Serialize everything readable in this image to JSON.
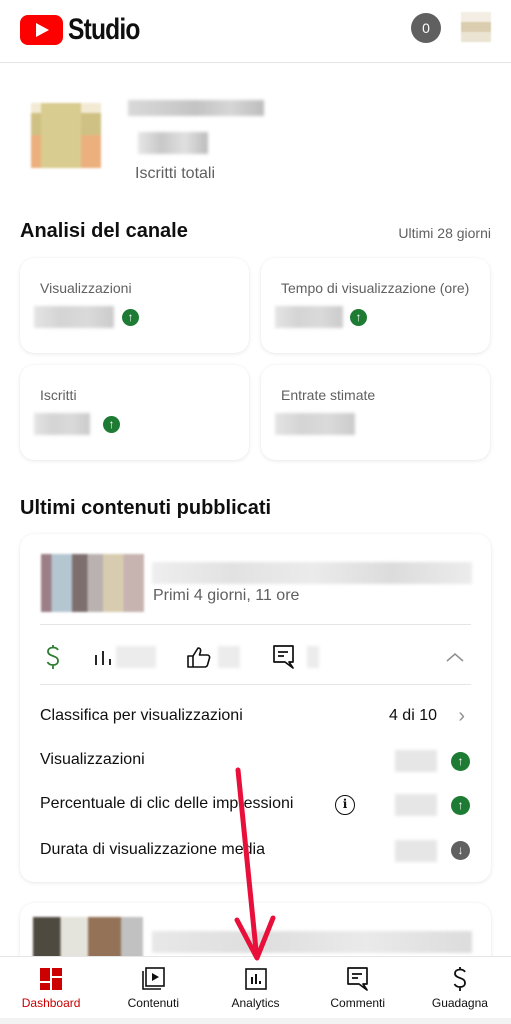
{
  "header": {
    "app_name": "Studio",
    "notification_count": "0"
  },
  "channel": {
    "subscribers_label": "Iscritti totali"
  },
  "analytics": {
    "title": "Analisi del canale",
    "range": "Ultimi 28 giorni",
    "cards": [
      {
        "label": "Visualizzazioni",
        "trend": "up"
      },
      {
        "label": "Tempo di visualizzazione (ore)",
        "trend": "up"
      },
      {
        "label": "Iscritti",
        "trend": "up"
      },
      {
        "label": "Entrate stimate",
        "trend": "none"
      }
    ]
  },
  "latest": {
    "title": "Ultimi contenuti pubblicati",
    "video": {
      "subtitle": "Primi 4 giorni, 11 ore",
      "stats_icons": [
        "dollar-icon",
        "bar-chart-icon",
        "thumbs-up-icon",
        "comment-icon"
      ],
      "rows": [
        {
          "label": "Classifica per visualizzazioni",
          "value": "4 di 10"
        },
        {
          "label": "Visualizzazioni",
          "trend": "up"
        },
        {
          "label": "Percentuale di clic delle impressioni",
          "trend": "up",
          "info": true
        },
        {
          "label": "Durata di visualizzazione media",
          "trend": "down"
        }
      ]
    }
  },
  "bottom_nav": {
    "items": [
      {
        "label": "Dashboard",
        "icon": "dashboard-icon",
        "active": true
      },
      {
        "label": "Contenuti",
        "icon": "content-icon"
      },
      {
        "label": "Analytics",
        "icon": "analytics-icon"
      },
      {
        "label": "Commenti",
        "icon": "comments-icon"
      },
      {
        "label": "Guadagna",
        "icon": "earn-icon"
      }
    ]
  },
  "colors": {
    "brand_red": "#ff0000",
    "active_red": "#cc0000",
    "trend_up": "#1e7b34",
    "trend_down": "#606060",
    "money_green": "#2e7d32",
    "annotation_arrow": "#e8103a"
  }
}
